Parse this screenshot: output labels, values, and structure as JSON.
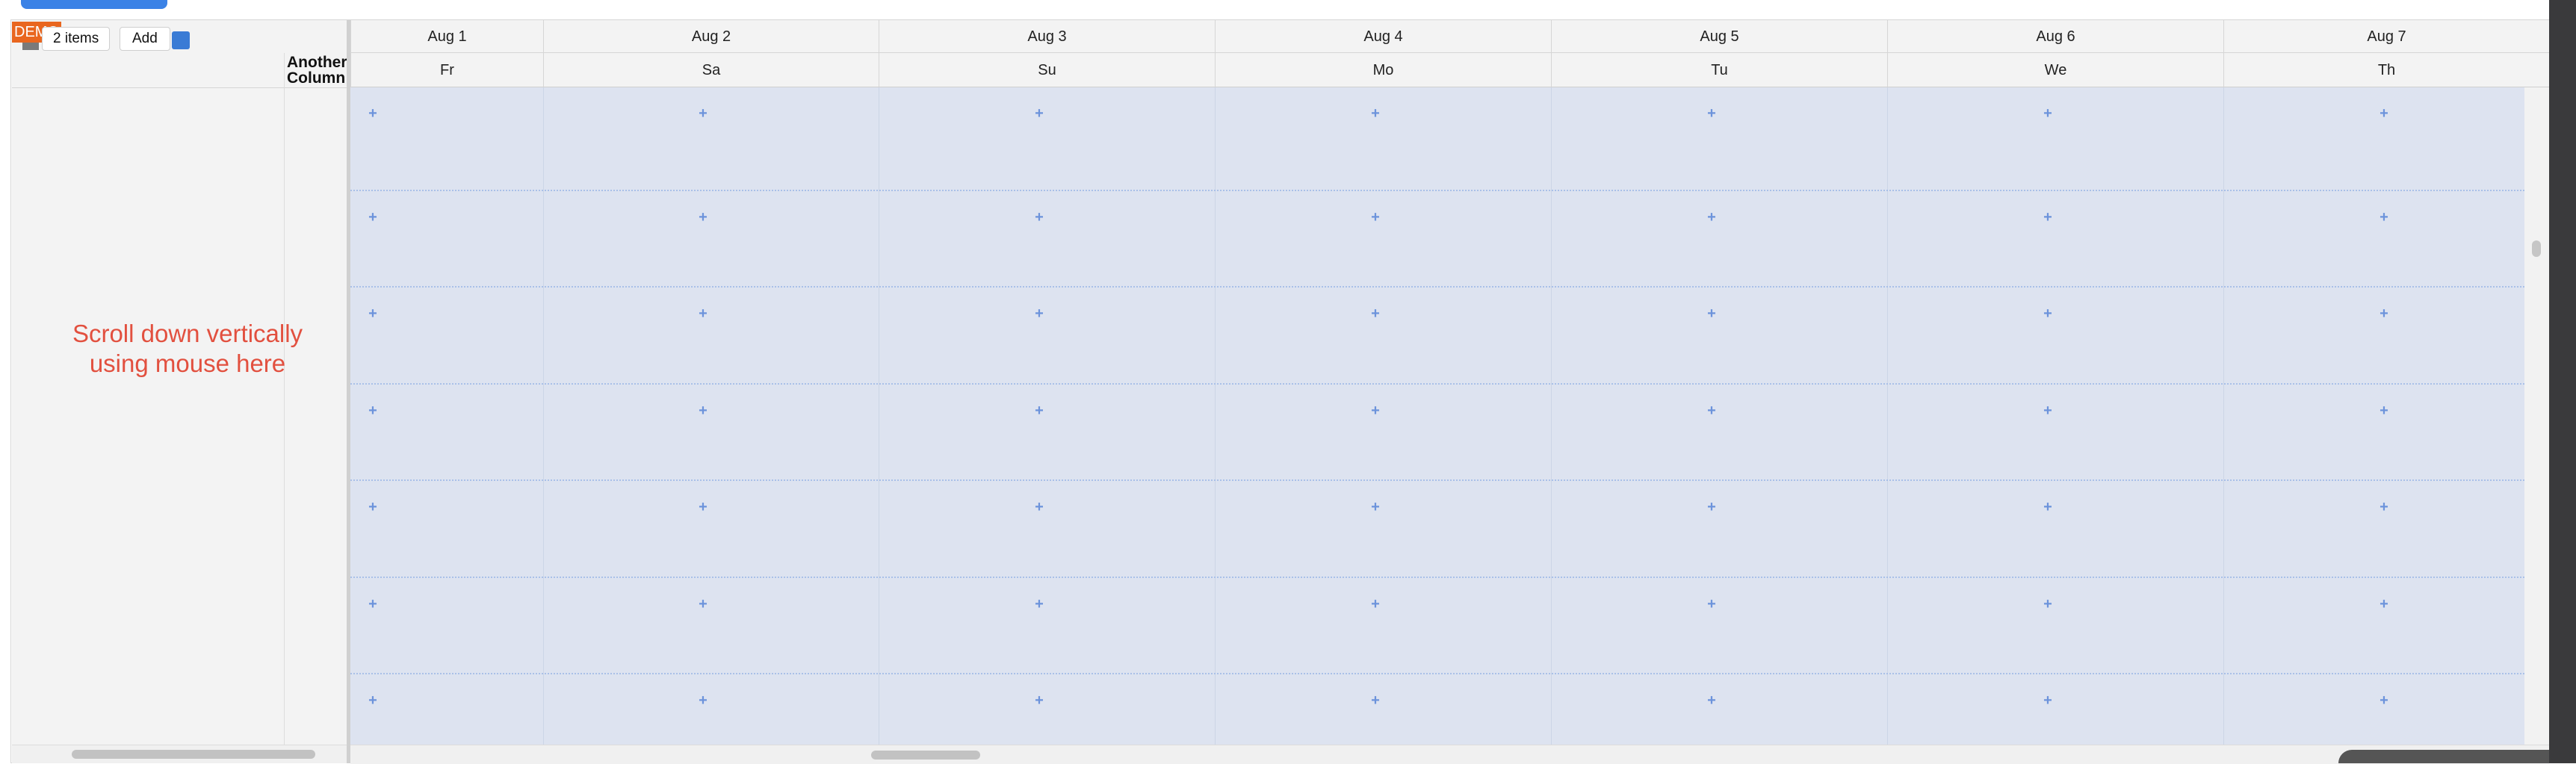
{
  "toolbar": {
    "demo_badge": "DEMO",
    "items_label": "2 items",
    "add_label": "Add"
  },
  "left_pane": {
    "column_header": "Another Column",
    "hint": "Scroll down vertically using mouse here"
  },
  "calendar": {
    "days": [
      {
        "date": "Aug 1",
        "dow": "Fr"
      },
      {
        "date": "Aug 2",
        "dow": "Sa"
      },
      {
        "date": "Aug 3",
        "dow": "Su"
      },
      {
        "date": "Aug 4",
        "dow": "Mo"
      },
      {
        "date": "Aug 5",
        "dow": "Tu"
      },
      {
        "date": "Aug 6",
        "dow": "We"
      },
      {
        "date": "Aug 7",
        "dow": "Th"
      }
    ],
    "row_count": 7,
    "add_cell_glyph": "+"
  },
  "colors": {
    "accent": "#3b82e6",
    "demo_badge": "#e9661f",
    "hint_text": "#e2503f",
    "grid_bg": "#dde3f0",
    "plus": "#6c93db"
  }
}
